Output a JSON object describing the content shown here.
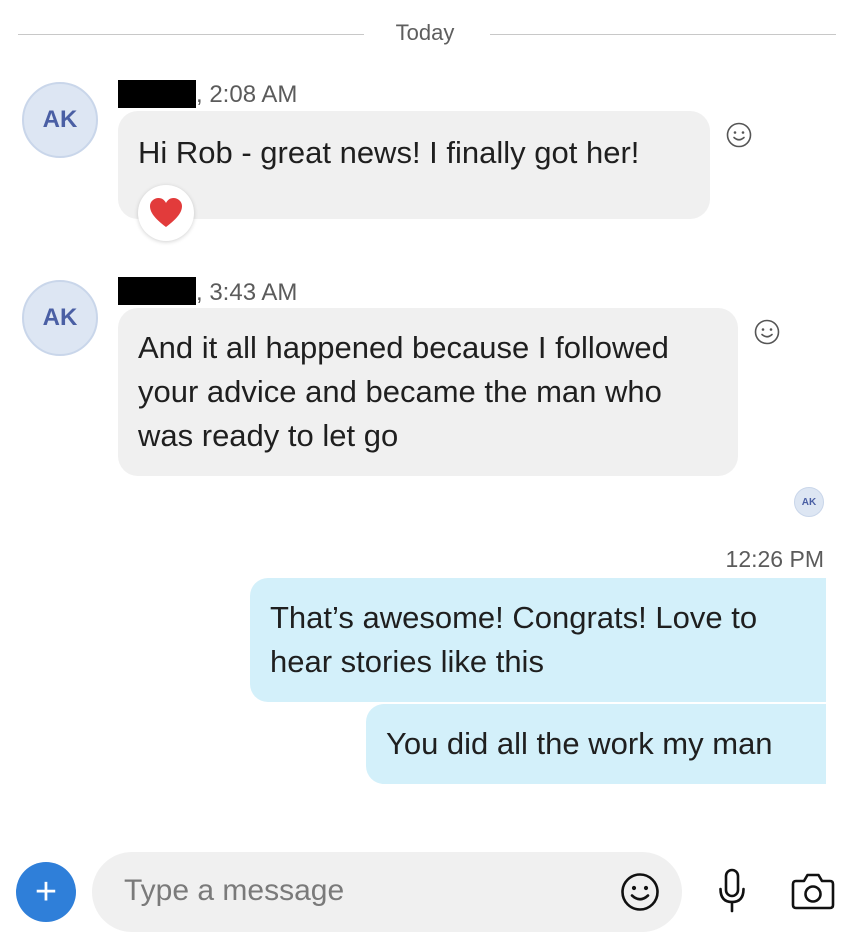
{
  "divider": {
    "label": "Today"
  },
  "messages": [
    {
      "avatar": "AK",
      "time": ", 2:08 AM",
      "lines": [
        "Hi Rob - great news! I finally got her!"
      ],
      "reaction": "heart-icon"
    },
    {
      "avatar": "AK",
      "time": ", 3:43 AM",
      "lines": [
        "And it all happened because I followed",
        "your advice and became the man who",
        "was ready to let go"
      ]
    }
  ],
  "read_receipt": {
    "avatar": "AK"
  },
  "outgoing": {
    "time": "12:26 PM",
    "bubbles": [
      {
        "lines": [
          "That’s awesome! Congrats! Love to",
          "hear stories like this"
        ]
      },
      {
        "lines": [
          "You did all the work my man"
        ]
      }
    ]
  },
  "composer": {
    "placeholder": "Type a message",
    "plus_label": "+",
    "icons": [
      "smile-icon",
      "microphone-icon",
      "camera-icon"
    ]
  },
  "colors": {
    "incoming": "#f0f0f0",
    "outgoing": "#d3f0fa",
    "accent": "#2f7fd9",
    "heart": "#e23b3b"
  }
}
